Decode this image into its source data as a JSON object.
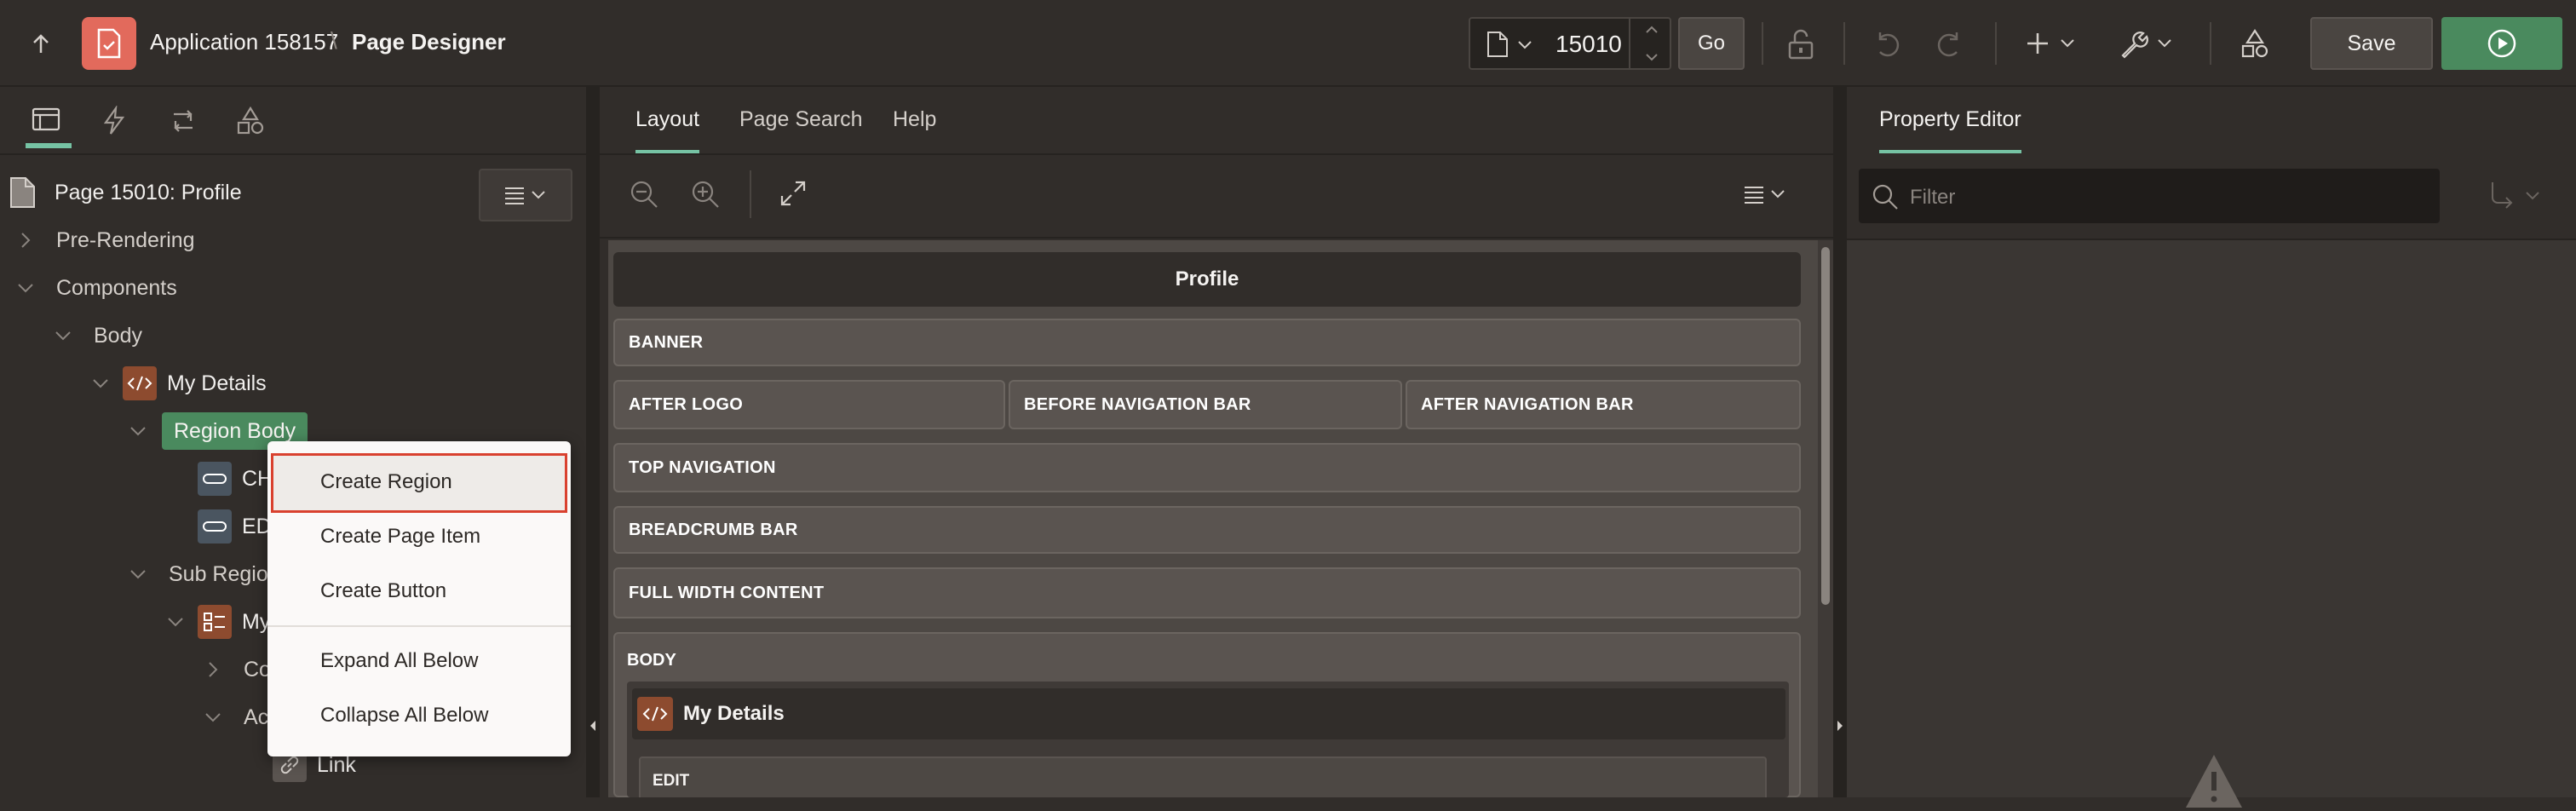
{
  "header": {
    "app_title": "Application 158157",
    "separator": "\\",
    "page_title": "Page Designer",
    "page_number": "15010",
    "go_label": "Go",
    "save_label": "Save"
  },
  "left_panel": {
    "tree": {
      "page": "Page 15010: Profile",
      "pre_rendering": "Pre-Rendering",
      "components": "Components",
      "body": "Body",
      "my_details": "My Details",
      "region_body": "Region Body",
      "item1_partial": "CH",
      "item2_partial": "ED",
      "sub_regions_partial": "Sub Region",
      "my_partial": "My",
      "co_partial": "Co",
      "ac_partial": "Ac",
      "link": "Link"
    }
  },
  "context_menu": {
    "items": [
      "Create Region",
      "Create Page Item",
      "Create Button",
      "Expand All Below",
      "Collapse All Below"
    ]
  },
  "center_panel": {
    "tabs": [
      "Layout",
      "Page Search",
      "Help"
    ],
    "active_tab": "Layout",
    "page_header": "Profile",
    "positions": {
      "banner": "BANNER",
      "after_logo": "AFTER LOGO",
      "before_nav": "BEFORE NAVIGATION BAR",
      "after_nav": "AFTER NAVIGATION BAR",
      "top_nav": "TOP NAVIGATION",
      "breadcrumb": "BREADCRUMB BAR",
      "full_width": "FULL WIDTH CONTENT",
      "body": "BODY",
      "my_details": "My Details",
      "edit": "EDIT"
    }
  },
  "right_panel": {
    "tab": "Property Editor",
    "filter_placeholder": "Filter"
  },
  "colors": {
    "accent_green": "#4a8a5e",
    "app_icon_red": "#e26a5c",
    "highlight_border": "#d9412f"
  }
}
